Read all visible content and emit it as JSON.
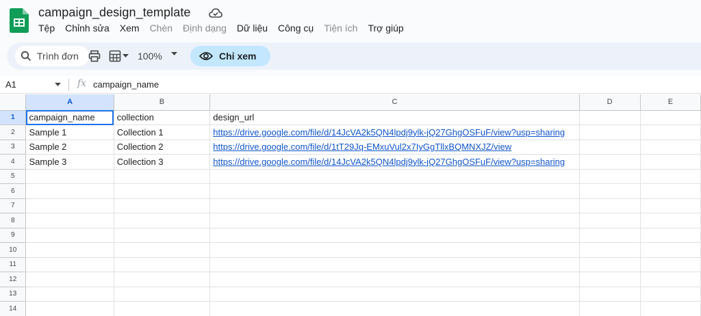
{
  "doc": {
    "title": "campaign_design_template"
  },
  "menu": [
    "Tệp",
    "Chỉnh sửa",
    "Xem",
    "Chèn",
    "Định dạng",
    "Dữ liệu",
    "Công cụ",
    "Tiện ích",
    "Trợ giúp"
  ],
  "menu_disabled": [
    false,
    false,
    false,
    true,
    true,
    false,
    false,
    true,
    false
  ],
  "toolbar": {
    "search_label": "Trình đơn",
    "zoom": "100%",
    "view_mode": "Chỉ xem"
  },
  "formula_bar": {
    "cell_ref": "A1",
    "fx": "fx",
    "content": "campaign_name"
  },
  "grid": {
    "columns": [
      "A",
      "B",
      "C",
      "D",
      "E"
    ],
    "rows": [
      [
        "campaign_name",
        "collection",
        "design_url",
        "",
        ""
      ],
      [
        "Sample 1",
        "Collection 1",
        "https://drive.google.com/file/d/14JcVA2k5QN4lpdj9ylk-jQ27GhgOSFuF/view?usp=sharing",
        "",
        ""
      ],
      [
        "Sample 2",
        "Collection 2",
        "https://drive.google.com/file/d/1tT29Jq-EMxuVul2x7IyGgTllxBQMNXJZ/view",
        "",
        ""
      ],
      [
        "Sample 3",
        "Collection 3",
        "https://drive.google.com/file/d/14JcVA2k5QN4lpdj9ylk-jQ27GhgOSFuF/view?usp=sharing",
        "",
        ""
      ],
      [
        "",
        "",
        "",
        "",
        ""
      ],
      [
        "",
        "",
        "",
        "",
        ""
      ],
      [
        "",
        "",
        "",
        "",
        ""
      ],
      [
        "",
        "",
        "",
        "",
        ""
      ],
      [
        "",
        "",
        "",
        "",
        ""
      ],
      [
        "",
        "",
        "",
        "",
        ""
      ],
      [
        "",
        "",
        "",
        "",
        ""
      ],
      [
        "",
        "",
        "",
        "",
        ""
      ],
      [
        "",
        "",
        "",
        "",
        ""
      ],
      [
        "",
        "",
        "",
        "",
        ""
      ]
    ]
  },
  "colors": {
    "accent": "#1a73e8",
    "link": "#1155cc",
    "view_pill": "#c2e7ff",
    "selected_header": "#d3e3fd"
  }
}
